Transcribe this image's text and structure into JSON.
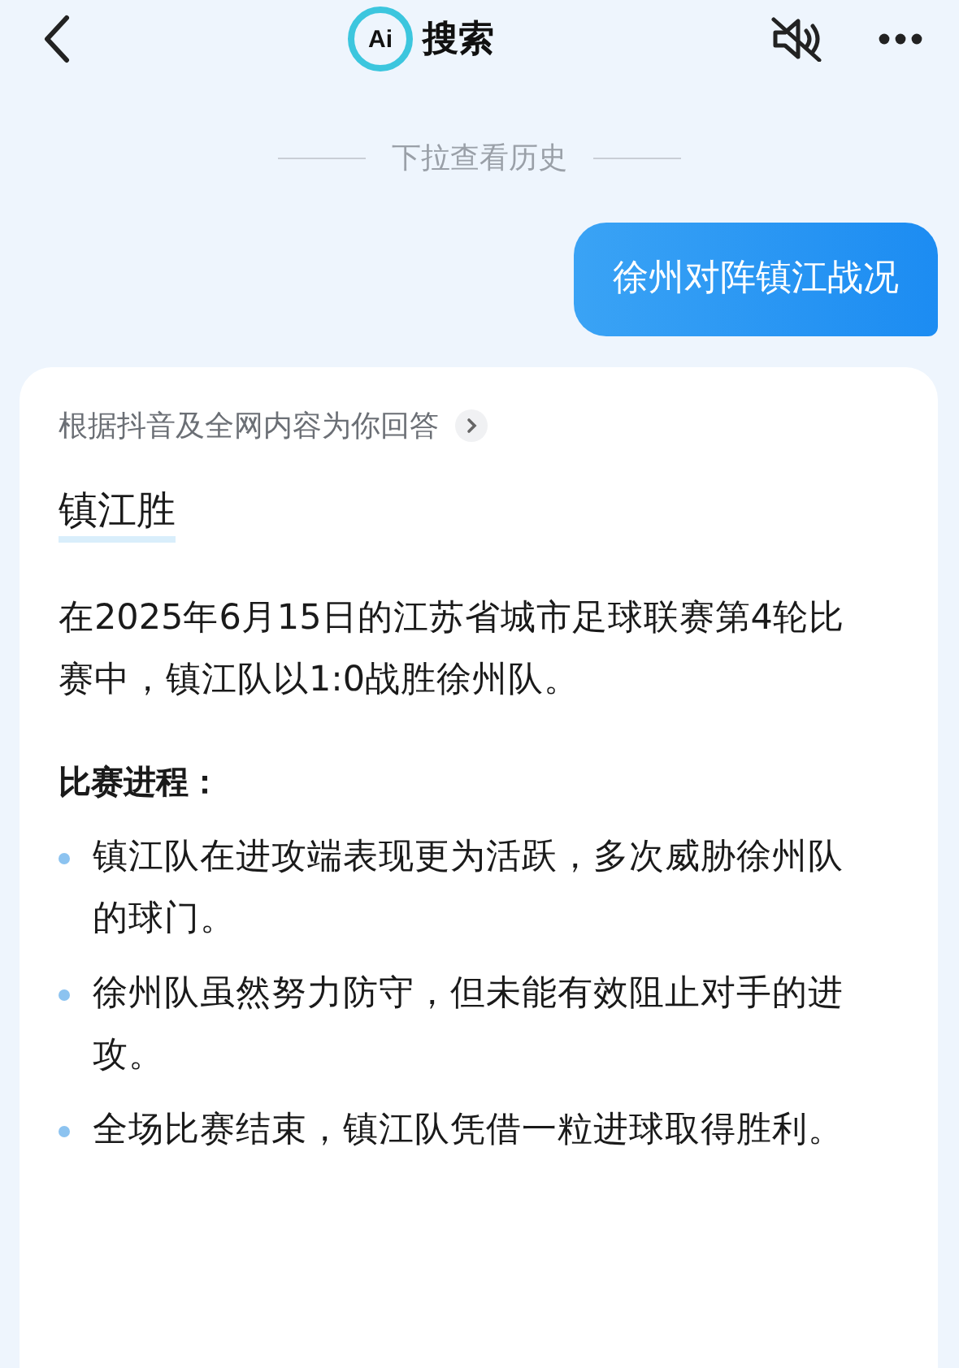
{
  "header": {
    "logo": "Ai",
    "title": "搜索"
  },
  "history_hint": "下拉查看历史",
  "user_message": "徐州对阵镇江战况",
  "answer": {
    "source": "根据抖音及全网内容为你回答",
    "headline": "镇江胜",
    "summary": "在2025年6月15日的江苏省城市足球联赛第4轮比赛中，镇江队以1:0战胜徐州队。",
    "section_title": "比赛进程：",
    "bullets": [
      "镇江队在进攻端表现更为活跃，多次威胁徐州队的球门。",
      "徐州队虽然努力防守，但未能有效阻止对手的进攻。",
      "全场比赛结束，镇江队凭借一粒进球取得胜利。"
    ]
  }
}
